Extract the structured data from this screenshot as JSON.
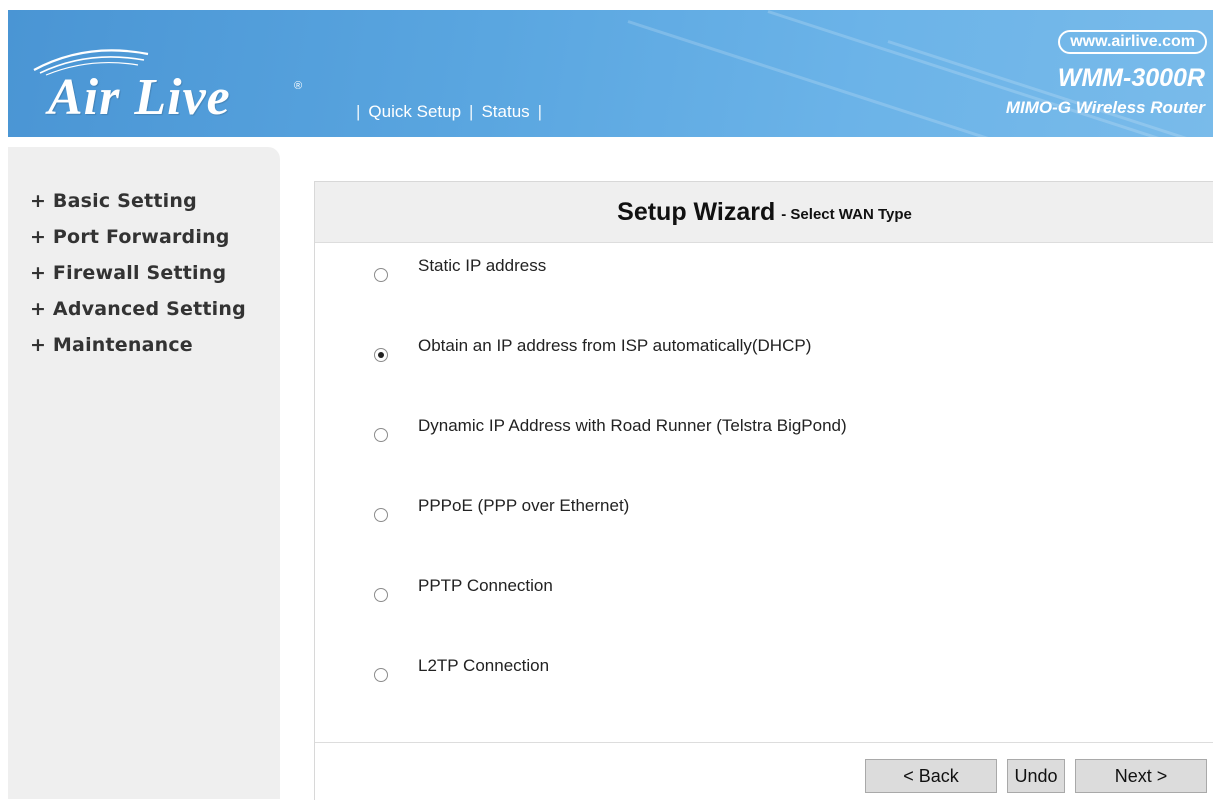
{
  "header": {
    "logo_text": "Air Live",
    "logo_reg": "®",
    "nav": [
      {
        "label": "Quick Setup"
      },
      {
        "label": "Status"
      }
    ],
    "url": "www.airlive.com",
    "model": "WMM-3000R",
    "model_desc": "MIMO-G Wireless Router"
  },
  "sidebar": {
    "items": [
      {
        "label": "+ Basic Setting"
      },
      {
        "label": "+ Port Forwarding"
      },
      {
        "label": "+ Firewall Setting"
      },
      {
        "label": "+ Advanced Setting"
      },
      {
        "label": "+ Maintenance"
      }
    ]
  },
  "wizard": {
    "title": "Setup Wizard",
    "subtitle": "- Select WAN Type",
    "selected_index": 1,
    "options": [
      {
        "label": "Static IP address"
      },
      {
        "label": "Obtain an IP address from ISP automatically(DHCP)"
      },
      {
        "label": "Dynamic IP Address with Road Runner (Telstra BigPond)"
      },
      {
        "label": "PPPoE (PPP over Ethernet)"
      },
      {
        "label": "PPTP Connection"
      },
      {
        "label": "L2TP Connection"
      }
    ],
    "buttons": {
      "back": "< Back",
      "undo": "Undo",
      "next": "Next >"
    }
  },
  "colors": {
    "header_blue": "#5aa6e0",
    "sidebar_bg": "#efefef",
    "button_bg": "#dcdcdc"
  }
}
